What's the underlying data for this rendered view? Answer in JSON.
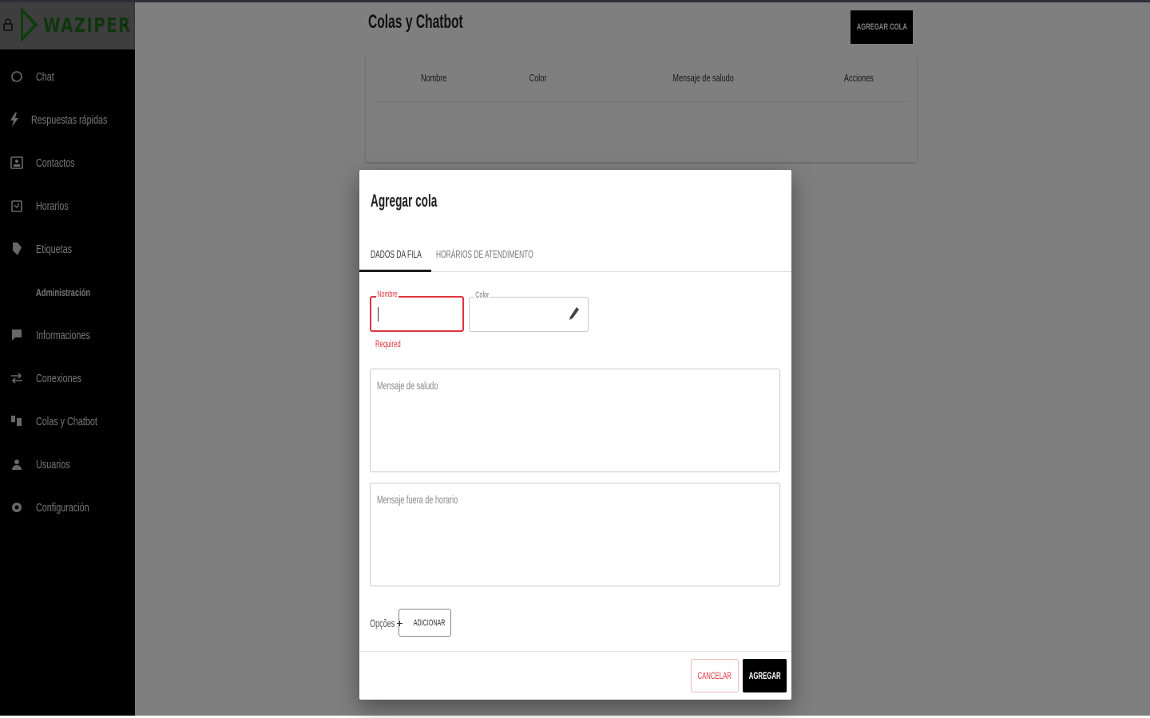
{
  "brand": {
    "name": "WAZIPER",
    "logo_color": "#1f6d1f"
  },
  "sidebar": {
    "items": [
      {
        "label": "Chat",
        "icon": "whatsapp-icon"
      },
      {
        "label": "Respuestas rápidas",
        "icon": "bolt-icon"
      },
      {
        "label": "Contactos",
        "icon": "contacts-icon"
      },
      {
        "label": "Horarios",
        "icon": "calendar-icon"
      },
      {
        "label": "Etiquetas",
        "icon": "tag-icon"
      },
      {
        "label": "Administración",
        "icon": "",
        "section": true
      },
      {
        "label": "Informaciones",
        "icon": "info-icon"
      },
      {
        "label": "Conexiones",
        "icon": "connections-icon"
      },
      {
        "label": "Colas y Chatbot",
        "icon": "queue-icon"
      },
      {
        "label": "Usuarios",
        "icon": "users-icon"
      },
      {
        "label": "Configuración",
        "icon": "settings-icon"
      }
    ]
  },
  "main": {
    "title": "Colas y Chatbot",
    "add_button": "AGREGAR COLA",
    "table": {
      "columns": [
        "Nombre",
        "Color",
        "Mensaje de saludo",
        "Acciones"
      ]
    }
  },
  "dialog": {
    "title": "Agregar cola",
    "tabs": [
      {
        "label": "DADOS DA FILA",
        "active": true
      },
      {
        "label": "HORÁRIOS DE ATENDIMENTO",
        "active": false
      }
    ],
    "name_field": {
      "label": "Nombre",
      "value": "",
      "error": "Required"
    },
    "color_field": {
      "label": "Color",
      "value": ""
    },
    "greeting_placeholder": "Mensaje de saludo",
    "out_of_hours_placeholder": "Mensaje fuera de horario",
    "options_label": "Opções",
    "add_option_label": "ADICIONAR",
    "cancel_label": "CANCELAR",
    "submit_label": "AGREGAR"
  },
  "colors": {
    "accent": "#000000",
    "error": "#e0343e",
    "sidebar_bg": "#000000"
  }
}
